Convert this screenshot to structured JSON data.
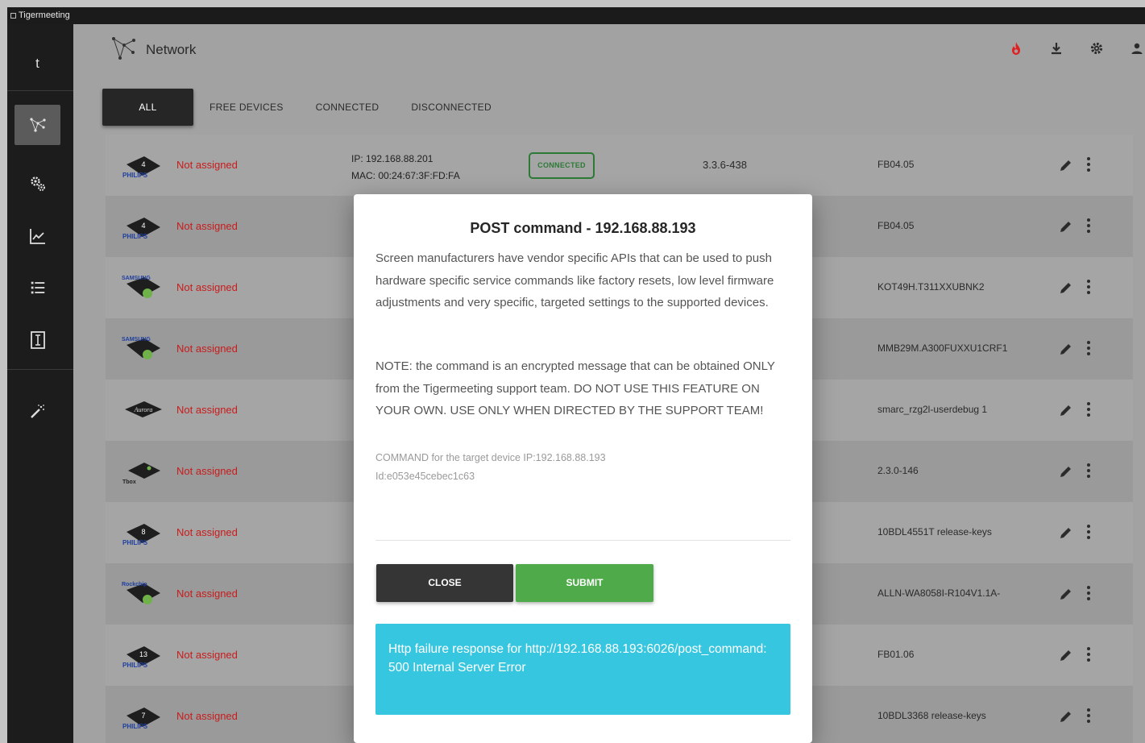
{
  "window": {
    "title": "Tigermeeting"
  },
  "sidebar": {
    "user_initial": "t"
  },
  "header": {
    "title": "Network"
  },
  "tabs": [
    {
      "label": "ALL"
    },
    {
      "label": "FREE DEVICES"
    },
    {
      "label": "CONNECTED"
    },
    {
      "label": "DISCONNECTED"
    }
  ],
  "devices": [
    {
      "brand": "PHILIPS",
      "badge": "4",
      "assignment": "Not assigned",
      "ip": "IP: 192.168.88.201",
      "mac": "MAC: 00:24:67:3F:FD:FA",
      "status": "CONNECTED",
      "version": "3.3.6-438",
      "firmware": "FB04.05"
    },
    {
      "brand": "PHILIPS",
      "badge": "4",
      "assignment": "Not assigned",
      "firmware": "FB04.05"
    },
    {
      "brand": "SAMSUNG",
      "assignment": "Not assigned",
      "firmware": "KOT49H.T311XXUBNK2"
    },
    {
      "brand": "SAMSUNG",
      "assignment": "Not assigned",
      "firmware": "MMB29M.A300FUXXU1CRF1"
    },
    {
      "brand": "Aurora",
      "assignment": "Not assigned",
      "firmware": "smarc_rzg2l-userdebug 1"
    },
    {
      "brand": "Tbox",
      "assignment": "Not assigned",
      "firmware": "2.3.0-146"
    },
    {
      "brand": "PHILIPS",
      "badge": "8",
      "assignment": "Not assigned",
      "firmware": "10BDL4551T release-keys"
    },
    {
      "brand": "Rockchip",
      "assignment": "Not assigned",
      "firmware": "ALLN-WA8058I-R104V1.1A-"
    },
    {
      "brand": "PHILIPS",
      "badge": "13",
      "assignment": "Not assigned",
      "firmware": "FB01.06"
    },
    {
      "brand": "PHILIPS",
      "badge": "7",
      "assignment": "Not assigned",
      "firmware": "10BDL3368 release-keys"
    }
  ],
  "modal": {
    "title": "POST command - 192.168.88.193",
    "description": "Screen manufacturers have vendor specific APIs that can be used to push hardware specific service commands like factory resets, low level firmware adjustments and very specific, targeted settings to the supported devices.",
    "note": "NOTE: the command is an encrypted message that can be obtained ONLY from the Tigermeeting support team. DO NOT USE THIS FEATURE ON YOUR OWN. USE ONLY WHEN DIRECTED BY THE SUPPORT TEAM!",
    "command_label_line1": "COMMAND for the target device IP:192.168.88.193",
    "command_label_line2": "Id:e053e45cebec1c63",
    "command_value": "",
    "close_label": "CLOSE",
    "submit_label": "SUBMIT",
    "error_message": "Http failure response for http://192.168.88.193:6026/post_command: 500 Internal Server Error"
  },
  "colors": {
    "accent_green": "#4fab4a",
    "error_cyan": "#37c6e0",
    "not_assigned_red": "#c81c1c",
    "connected_green": "#2d7a36"
  }
}
